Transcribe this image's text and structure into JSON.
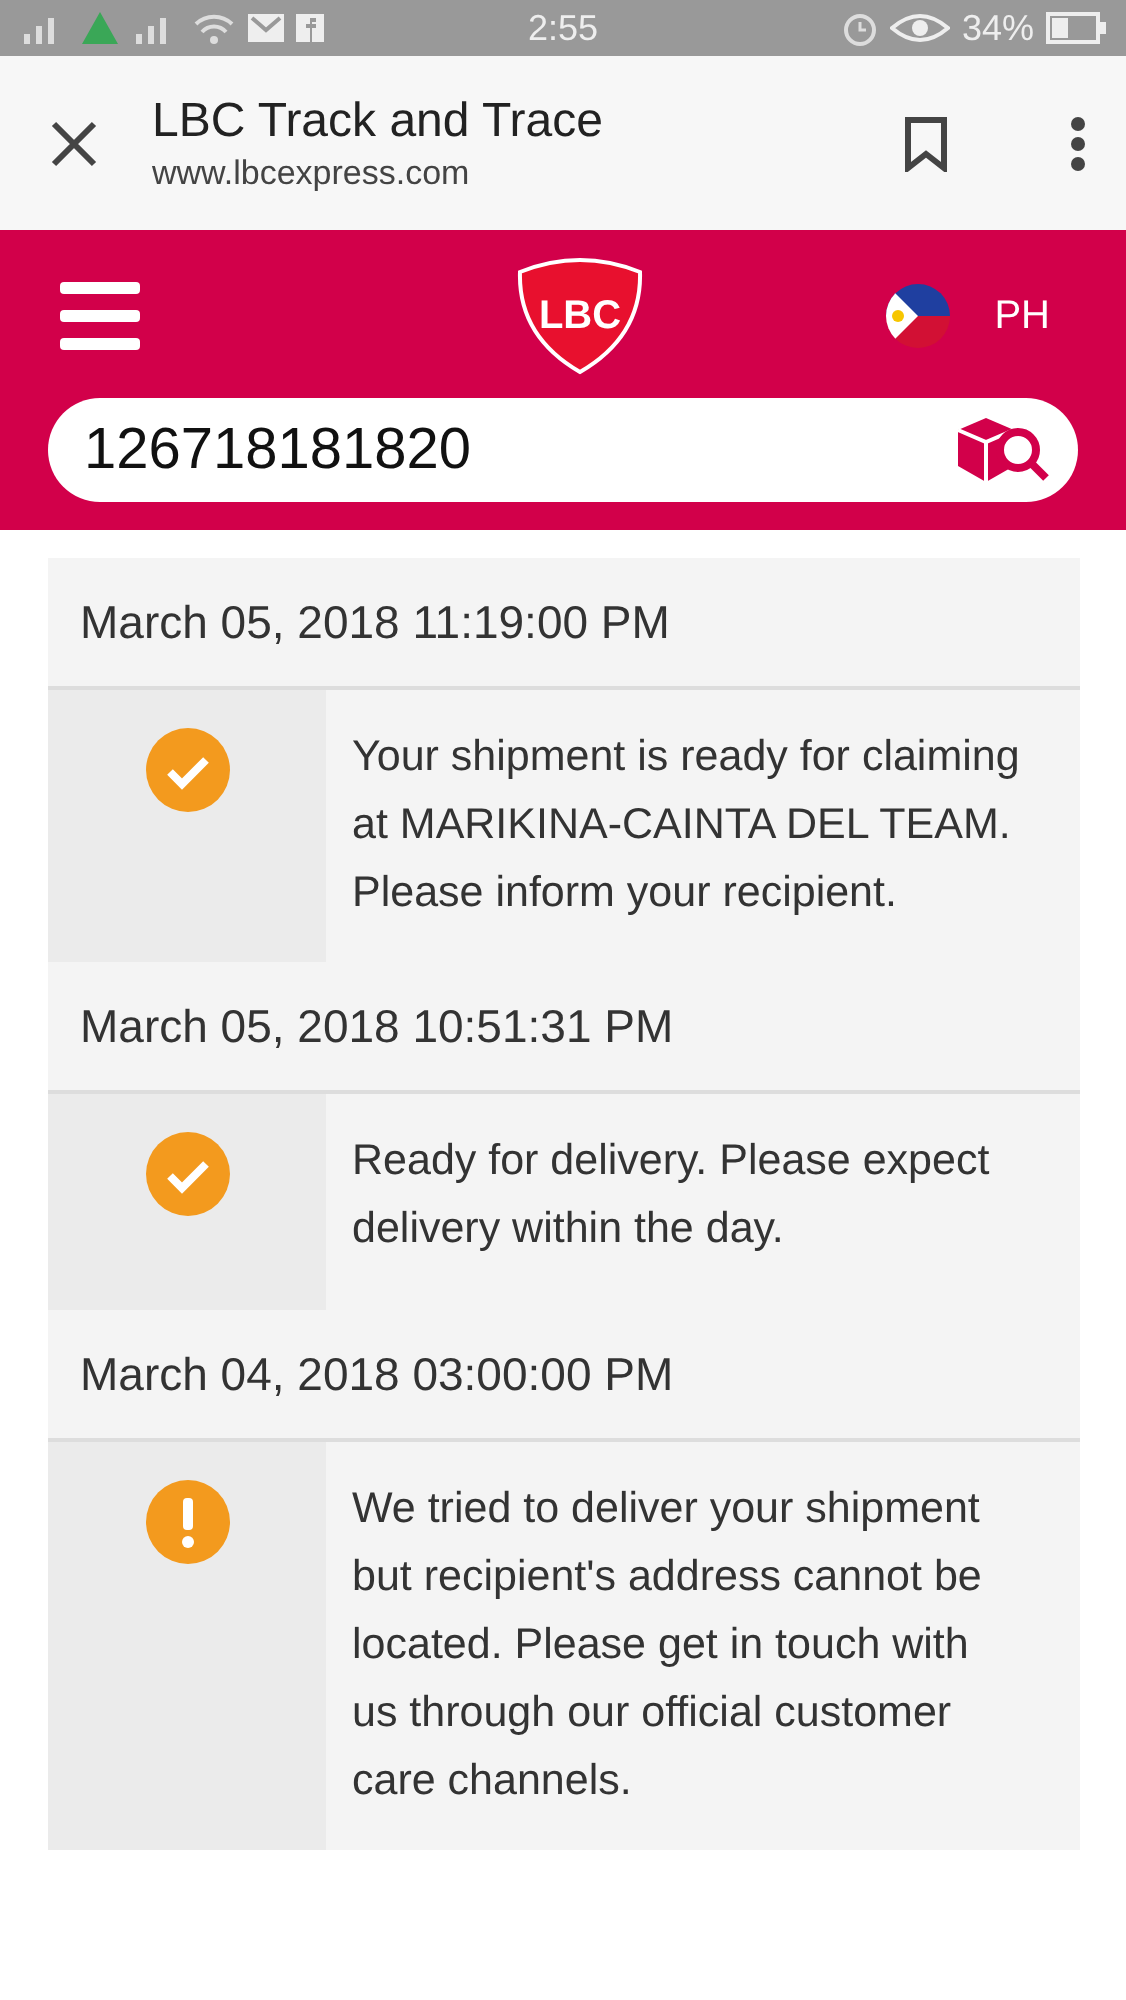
{
  "status_bar": {
    "time": "2:55",
    "battery": "34%"
  },
  "browser": {
    "title": "LBC Track and Trace",
    "url": "www.lbcexpress.com"
  },
  "header": {
    "logo": "LBC",
    "country": "PH"
  },
  "search": {
    "value": "126718181820"
  },
  "events": [
    {
      "date": "March 05, 2018 11:19:00 PM",
      "kind": "done",
      "message": "Your shipment is ready for claiming at MARIKINA-CAINTA DEL TEAM. Please inform your recipient."
    },
    {
      "date": "March 05, 2018 10:51:31 PM",
      "kind": "done",
      "message": "Ready for delivery. Please expect delivery within the day."
    },
    {
      "date": "March 04, 2018 03:00:00 PM",
      "kind": "alert",
      "message": "We tried to deliver your shipment but recipient's address cannot be located. Please get in touch with us through our official customer care channels."
    }
  ]
}
